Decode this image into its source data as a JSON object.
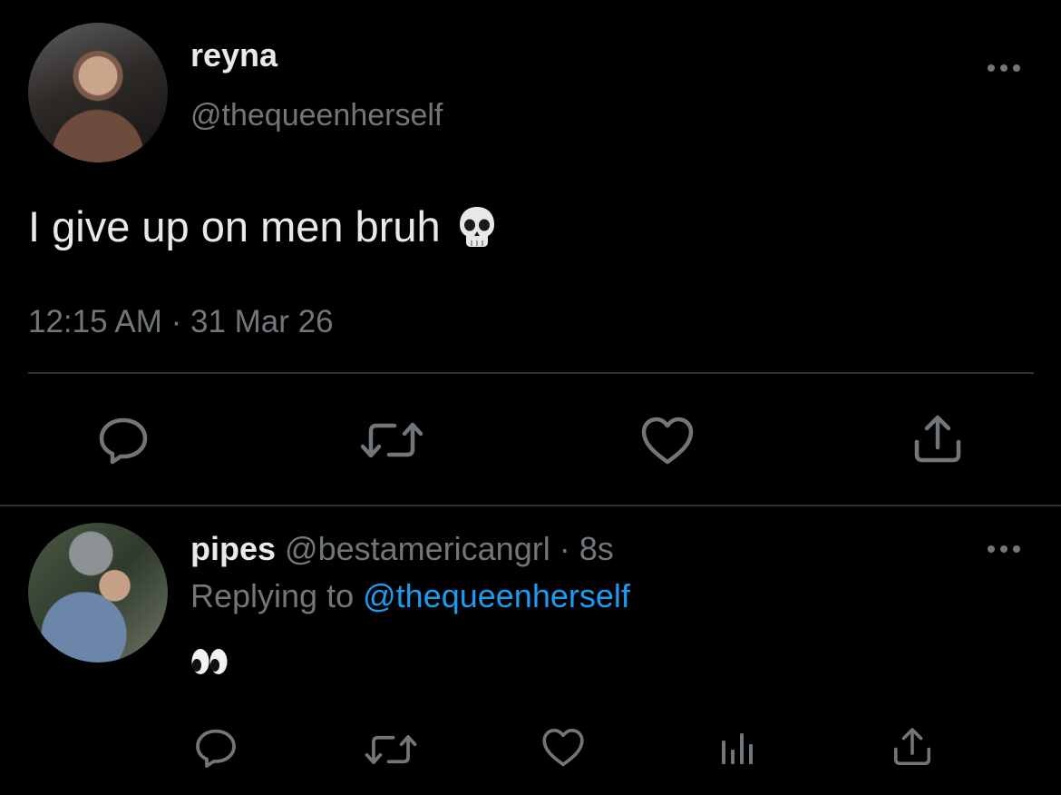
{
  "main_tweet": {
    "author_name": "reyna",
    "author_handle": "@thequeenherself",
    "text": "I give up on men bruh",
    "text_emoji_icon": "skull-emoji",
    "timestamp": "12:15 AM · 31 Mar 26",
    "actions": [
      "reply-icon",
      "retweet-icon",
      "like-icon",
      "share-icon"
    ]
  },
  "reply_tweet": {
    "author_name": "pipes",
    "author_handle": "@bestamericangrl",
    "separator": "·",
    "time": "8s",
    "replying_prefix": "Replying to",
    "replying_to": "@thequeenherself",
    "text_emoji_icon": "eyes-emoji",
    "actions": [
      "reply-icon",
      "retweet-icon",
      "like-icon",
      "analytics-icon",
      "share-icon"
    ]
  },
  "colors": {
    "background": "#000000",
    "primary_text": "#e7e9ea",
    "secondary_text": "#71767b",
    "link": "#1d9bf0",
    "divider": "#2f3336"
  }
}
